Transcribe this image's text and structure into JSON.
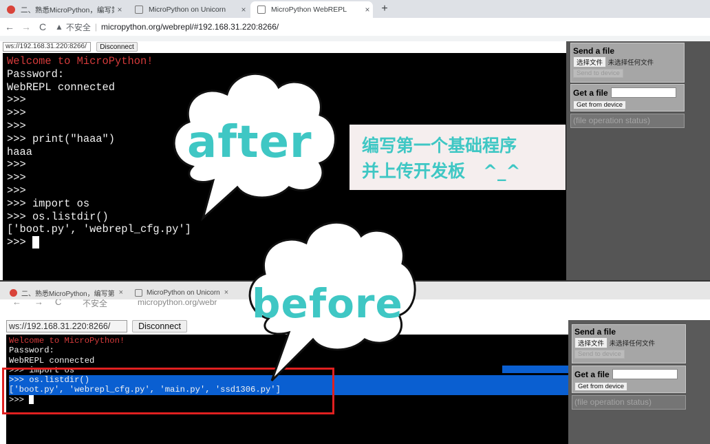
{
  "browser": {
    "tabs": [
      {
        "label": "二、熟悉MicroPython，编写第",
        "icon": "favicon-red-icon",
        "active": false
      },
      {
        "label": "MicroPython on Unicorn",
        "icon": "page-icon",
        "active": false
      },
      {
        "label": "MicroPython WebREPL",
        "icon": "page-icon",
        "active": true
      }
    ],
    "new_tab": "+",
    "close_glyph": "×",
    "back_glyph": "←",
    "forward_glyph": "→",
    "reload_glyph": "C",
    "warning_glyph": "▲",
    "insecure_label": "不安全",
    "url": "micropython.org/webrepl/#192.168.31.220:8266/"
  },
  "top": {
    "ws_url": "ws://192.168.31.220:8266/",
    "disconnect_label": "Disconnect",
    "terminal_lines": [
      {
        "text": "Welcome to MicroPython!",
        "red": true
      },
      {
        "text": "Password:",
        "red": false
      },
      {
        "text": "WebREPL connected",
        "red": false
      },
      {
        "text": ">>>",
        "red": false
      },
      {
        "text": ">>>",
        "red": false
      },
      {
        "text": ">>>",
        "red": false
      },
      {
        "text": ">>> print(\"haaa\")",
        "red": false
      },
      {
        "text": "haaa",
        "red": false
      },
      {
        "text": ">>>",
        "red": false
      },
      {
        "text": ">>>",
        "red": false
      },
      {
        "text": ">>>",
        "red": false
      },
      {
        "text": ">>> import os",
        "red": false
      },
      {
        "text": ">>> os.listdir()",
        "red": false
      },
      {
        "text": "['boot.py', 'webrepl_cfg.py']",
        "red": false
      },
      {
        "text": ">>> ",
        "red": false
      }
    ],
    "send_file_title": "Send a file",
    "choose_file_label": "选择文件",
    "no_file_label": "未选择任何文件",
    "send_to_device_label": "Send to device",
    "get_file_title": "Get a file",
    "get_from_device_label": "Get from device",
    "file_status": "(file operation status)"
  },
  "caption": {
    "line1": "编写第一个基础程序",
    "line2": "并上传开发板   ^_^"
  },
  "bubbles": {
    "after": "after",
    "before": "before"
  },
  "bottom": {
    "tabs": [
      {
        "label": "二、熟悉MicroPython，编写第",
        "icon": "favicon-red-icon"
      },
      {
        "label": "MicroPython on Unicorn",
        "icon": "page-icon"
      }
    ],
    "addr_fragment": "micropython.org/webr",
    "ws_url": "ws://192.168.31.220:8266/",
    "disconnect_label": "Disconnect",
    "terminal_lines": [
      {
        "text": "Welcome to MicroPython!",
        "red": true,
        "hl": false
      },
      {
        "text": "Password:",
        "red": false,
        "hl": false
      },
      {
        "text": "WebREPL connected",
        "red": false,
        "hl": false
      },
      {
        "text": ">>> import os",
        "red": false,
        "hl": false
      },
      {
        "text": ">>> os.listdir()",
        "red": false,
        "hl": true
      },
      {
        "text": "['boot.py', 'webrepl_cfg.py', 'main.py', 'ssd1306.py']",
        "red": false,
        "hl": true
      },
      {
        "text": ">>> ",
        "red": false,
        "hl": false
      }
    ],
    "send_file_title": "Send a file",
    "choose_file_label": "选择文件",
    "no_file_label": "未选择任何文件",
    "send_to_device_label": "Send to device",
    "get_file_title": "Get a file",
    "get_from_device_label": "Get from device",
    "file_status": "(file operation status)"
  },
  "colors": {
    "accent_cyan": "#3fc7c4",
    "terminal_red": "#d63b3b",
    "highlight_blue": "#0a5fd1",
    "frame_red": "#e02020"
  }
}
